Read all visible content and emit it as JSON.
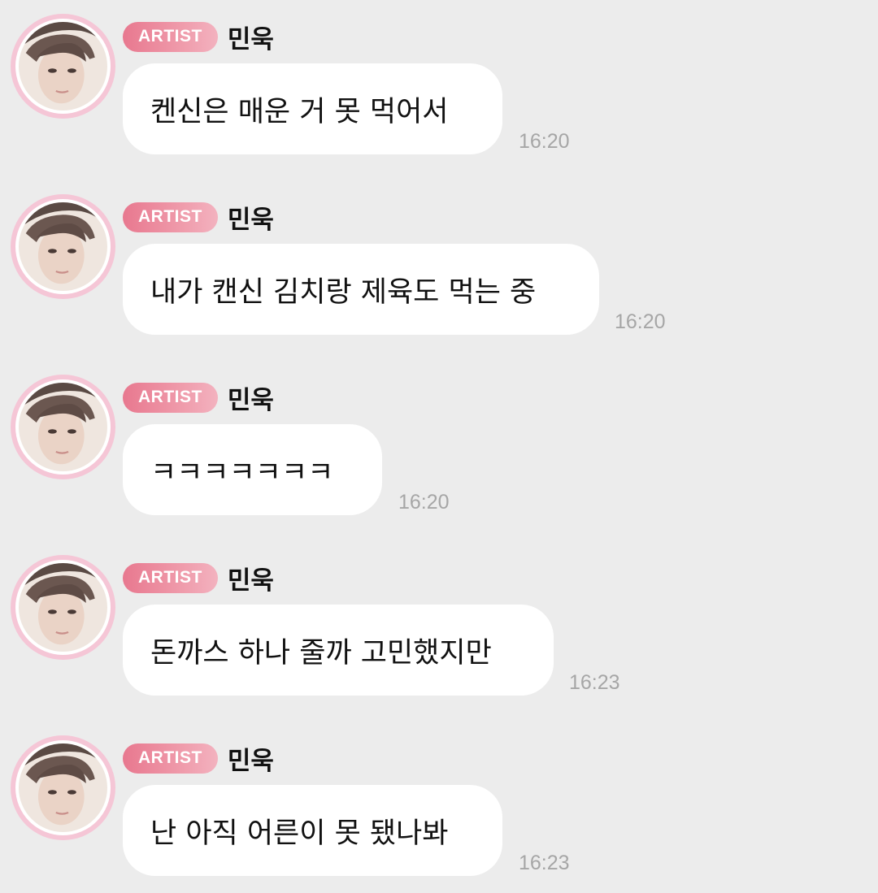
{
  "messages": [
    {
      "badge": "ARTIST",
      "sender": "민욱",
      "text": "켄신은 매운 거 못 먹어서",
      "time": "16:20"
    },
    {
      "badge": "ARTIST",
      "sender": "민욱",
      "text": "내가 캔신 김치랑 제육도 먹는 중",
      "time": "16:20"
    },
    {
      "badge": "ARTIST",
      "sender": "민욱",
      "text": "ㅋㅋㅋㅋㅋㅋㅋ",
      "time": "16:20"
    },
    {
      "badge": "ARTIST",
      "sender": "민욱",
      "text": "돈까스 하나 줄까 고민했지만",
      "time": "16:23"
    },
    {
      "badge": "ARTIST",
      "sender": "민욱",
      "text": "난 아직 어른이 못 됐나봐",
      "time": "16:23"
    }
  ],
  "colors": {
    "background": "#ececec",
    "bubble": "#ffffff",
    "badge_start": "#e8788f",
    "badge_end": "#f3b2bf",
    "avatar_ring": "#f5c6d6",
    "time_text": "#a6a6a6"
  }
}
